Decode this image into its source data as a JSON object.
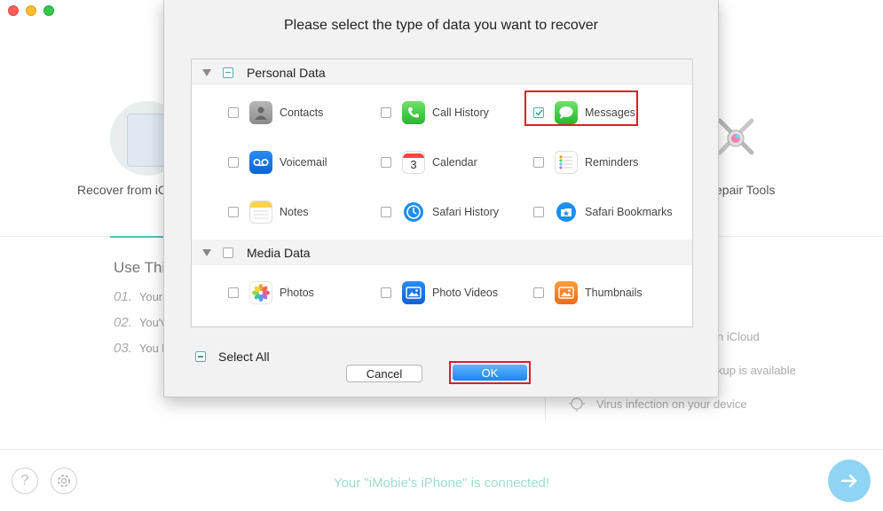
{
  "window": {
    "controls": [
      "close",
      "minimize",
      "zoom"
    ]
  },
  "background": {
    "left_option_label": "Recover from iC",
    "right_option_label": "epair Tools",
    "use_title": "Use Thi",
    "steps": [
      {
        "num": "01.",
        "text": "Your"
      },
      {
        "num": "02.",
        "text": "You'v"
      },
      {
        "num": "03.",
        "text": "You l"
      }
    ],
    "right_lines": [
      "n iCloud",
      "kup is available"
    ],
    "virus_text": "Virus infection on your device",
    "status": "Your \"iMobie's iPhone\" is connected!",
    "help_symbol": "?"
  },
  "dialog": {
    "title": "Please select the type of data you want to recover",
    "sections": [
      {
        "label": "Personal Data",
        "state": "mixed",
        "items": [
          {
            "label": "Contacts",
            "icon": "contacts-icon",
            "checked": false
          },
          {
            "label": "Call History",
            "icon": "phone-icon",
            "checked": false
          },
          {
            "label": "Messages",
            "icon": "messages-icon",
            "checked": true
          },
          {
            "label": "Voicemail",
            "icon": "voicemail-icon",
            "checked": false
          },
          {
            "label": "Calendar",
            "icon": "calendar-icon",
            "checked": false
          },
          {
            "label": "Reminders",
            "icon": "reminders-icon",
            "checked": false
          },
          {
            "label": "Notes",
            "icon": "notes-icon",
            "checked": false
          },
          {
            "label": "Safari History",
            "icon": "safari-history-icon",
            "checked": false
          },
          {
            "label": "Safari Bookmarks",
            "icon": "safari-bookmarks-icon",
            "checked": false
          }
        ]
      },
      {
        "label": "Media Data",
        "state": "unchecked",
        "items": [
          {
            "label": "Photos",
            "icon": "photos-icon",
            "checked": false
          },
          {
            "label": "Photo Videos",
            "icon": "photo-videos-icon",
            "checked": false
          },
          {
            "label": "Thumbnails",
            "icon": "thumbnails-icon",
            "checked": false
          }
        ]
      }
    ],
    "calendar_day": "3",
    "select_all_label": "Select All",
    "cancel_label": "Cancel",
    "ok_label": "OK"
  },
  "colors": {
    "accent": "#46b7a8",
    "highlight": "#d8202a",
    "ok_button": "#1f84f4",
    "status_text": "#9fdcd2"
  }
}
